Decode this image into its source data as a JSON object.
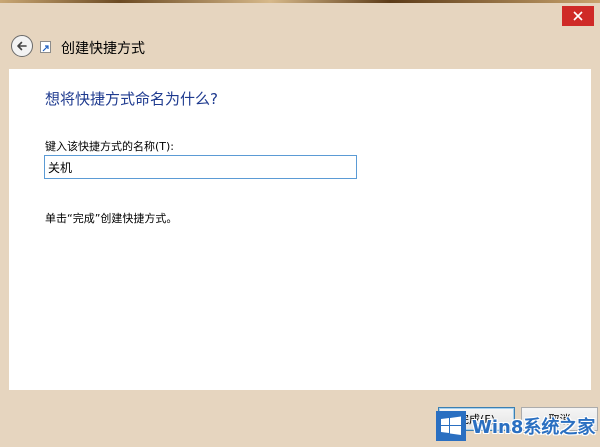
{
  "window": {
    "title": "创建快捷方式"
  },
  "icons": {
    "back": "back-arrow-icon",
    "shortcut": "shortcut-icon",
    "close": "close-icon"
  },
  "main": {
    "heading": "想将快捷方式命名为什么?",
    "name_label": "键入该快捷方式的名称(T):",
    "name_value": "关机",
    "hint": "单击“完成”创建快捷方式。"
  },
  "buttons": {
    "finish_label": "完成(F)",
    "cancel_label": "取消"
  },
  "watermark": {
    "text": "Win8系统之家"
  },
  "colors": {
    "heading": "#1e3a8f",
    "input_border": "#5b9bd5",
    "close": "#cf2a27",
    "frame": "#e6d5bf"
  }
}
